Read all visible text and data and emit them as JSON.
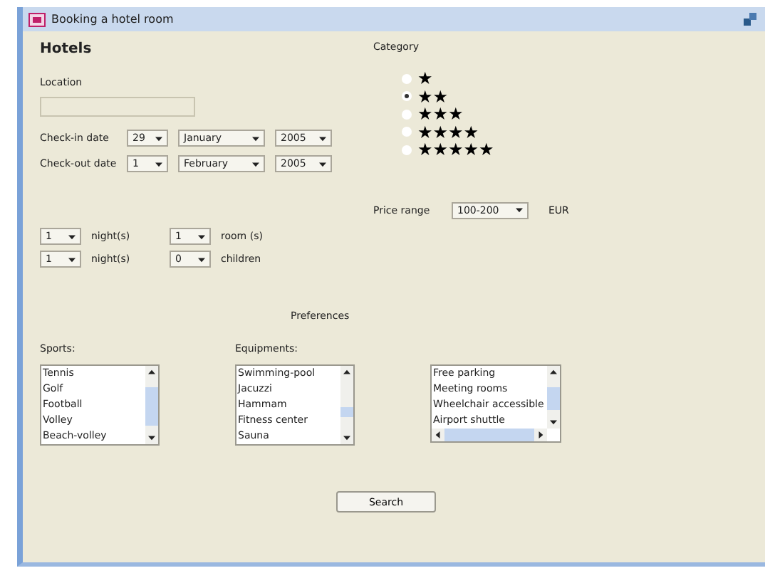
{
  "window": {
    "title": "Booking a hotel room"
  },
  "heading": "Hotels",
  "location": {
    "label": "Location"
  },
  "dates": [
    {
      "label": "Check-in date",
      "day": "29",
      "month": "January",
      "year": "2005"
    },
    {
      "label": "Check-out date",
      "day": "1",
      "month": "February",
      "year": "2005"
    }
  ],
  "counts": [
    {
      "value": "1",
      "label": "night(s)",
      "value_2": "1",
      "label_2": "room (s)"
    },
    {
      "value": "1",
      "label": "night(s)",
      "value_2": "0",
      "label_2": "children"
    }
  ],
  "category": {
    "label": "Category",
    "options": [
      {
        "label": "★",
        "selected": false
      },
      {
        "label": "★★",
        "selected": true
      },
      {
        "label": "★★★",
        "selected": false
      },
      {
        "label": "★★★★",
        "selected": false
      },
      {
        "label": "★★★★★",
        "selected": false
      }
    ]
  },
  "price": {
    "label": "Price range",
    "value": "100-200",
    "unit": "EUR"
  },
  "preferences": {
    "title": "Preferences",
    "lists": [
      {
        "label": "Sports:",
        "items": [
          "Tennis",
          "Golf",
          "Football",
          "Volley",
          "Beach-volley"
        ],
        "hscroll": false
      },
      {
        "label": "Equipments:",
        "items": [
          "Swimming-pool",
          "Jacuzzi",
          "Hammam",
          "Fitness center",
          "Sauna"
        ],
        "hscroll": false
      },
      {
        "items": [
          "Free parking",
          "Meeting rooms",
          "Wheelchair accessible",
          "Airport shuttle"
        ],
        "hscroll": true
      }
    ]
  },
  "search_button": "Search"
}
